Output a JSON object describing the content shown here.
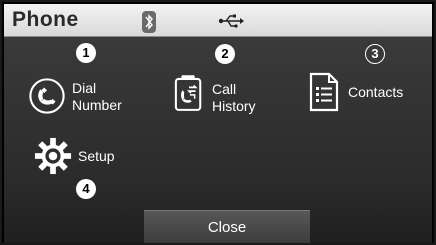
{
  "header": {
    "title": "Phone",
    "status_icons": [
      "bluetooth-icon",
      "usb-icon"
    ]
  },
  "menu": {
    "items": [
      {
        "number": "1",
        "label_line1": "Dial",
        "label_line2": "Number",
        "icon": "phone-handset-icon"
      },
      {
        "number": "2",
        "label_line1": "Call",
        "label_line2": "History",
        "icon": "call-history-icon"
      },
      {
        "number": "3",
        "label_line1": "Contacts",
        "label_line2": "",
        "icon": "contacts-document-icon"
      },
      {
        "number": "4",
        "label_line1": "Setup",
        "label_line2": "",
        "icon": "gear-icon"
      }
    ]
  },
  "footer": {
    "close_label": "Close"
  },
  "colors": {
    "titlebar": "#e6e6e6",
    "panel": "#2f2f2f",
    "text": "#ffffff",
    "close_button": "#4a4a4a"
  }
}
